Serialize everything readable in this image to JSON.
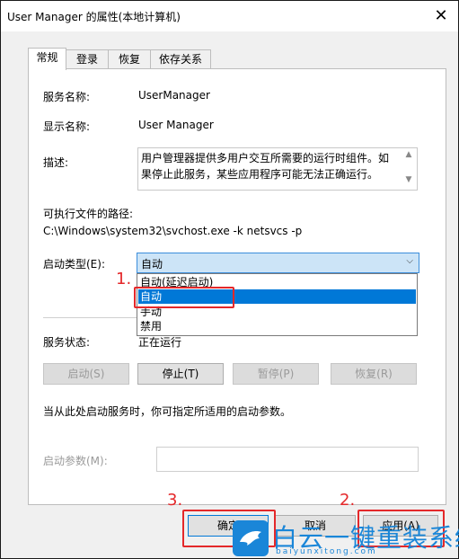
{
  "window": {
    "title": "User Manager 的属性(本地计算机)"
  },
  "tabs": [
    {
      "label": "常规",
      "active": true
    },
    {
      "label": "登录"
    },
    {
      "label": "恢复"
    },
    {
      "label": "依存关系"
    }
  ],
  "general": {
    "service_name_label": "服务名称:",
    "service_name": "UserManager",
    "display_name_label": "显示名称:",
    "display_name": "User Manager",
    "description_label": "描述:",
    "description": "用户管理器提供多用户交互所需要的运行时组件。如果停止此服务，某些应用程序可能无法正确运行。",
    "path_label": "可执行文件的路径:",
    "path": "C:\\Windows\\system32\\svchost.exe -k netsvcs -p",
    "startup_type_label": "启动类型(E):",
    "startup_type_value": "自动",
    "startup_options": [
      "自动(延迟启动)",
      "自动",
      "手动",
      "禁用"
    ],
    "status_label": "服务状态:",
    "status_value": "正在运行",
    "buttons": {
      "start": "启动(S)",
      "stop": "停止(T)",
      "pause": "暂停(P)",
      "resume": "恢复(R)"
    },
    "hint": "当从此处启动服务时，你可指定所适用的启动参数。",
    "param_label": "启动参数(M):"
  },
  "footer": {
    "ok": "确定",
    "cancel": "取消",
    "apply": "应用(A)"
  },
  "annotations": {
    "n1": "1.",
    "n2": "2.",
    "n3": "3."
  },
  "watermark": {
    "text": "白云一键重装系统",
    "sub": "baiyunxitong.com"
  },
  "colors": {
    "accent": "#0078d7",
    "highlight": "#e4282a",
    "watermark": "#1a86d8"
  }
}
